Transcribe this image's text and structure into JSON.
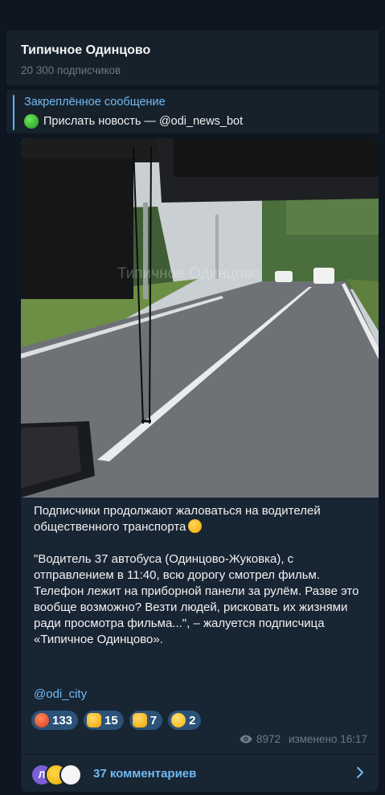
{
  "channel": {
    "title": "Типичное Одинцово",
    "subscribers": "20 300 подписчиков"
  },
  "pinned": {
    "title": "Закреплённое сообщение",
    "text": "Прислать новость — @odi_news_bot"
  },
  "post": {
    "watermark": "Типичное Одинцово",
    "paragraph1": "Подписчики продолжают жаловаться на водителей общественного транспорта",
    "paragraph2": "\"Водитель 37 автобуса (Одинцово-Жуковка), с отправлением в 11:40, всю дорогу смотрел фильм. Телефон лежит на приборной панели за рулём. Разве это вообще возможно? Везти людей, рисковать их жизнями ради просмотра фильма...\", – жалуется подписчица «Типичное Одинцово».",
    "link": "@odi_city",
    "reactions": [
      {
        "icon": "angry-face-icon",
        "count": "133"
      },
      {
        "icon": "thumbs-up-icon",
        "count": "15"
      },
      {
        "icon": "thumbs-down-icon",
        "count": "7"
      },
      {
        "icon": "grinning-face-icon",
        "count": "2"
      }
    ],
    "views": "8972",
    "edited": "изменено 16:17"
  },
  "comments": {
    "avatar_letter": "Л",
    "label": "37 комментариев"
  },
  "colors": {
    "background": "#0e1621",
    "panel": "#17212b",
    "message_bubble": "#182533",
    "accent": "#71baf3",
    "reaction_bg": "#2b5278"
  }
}
